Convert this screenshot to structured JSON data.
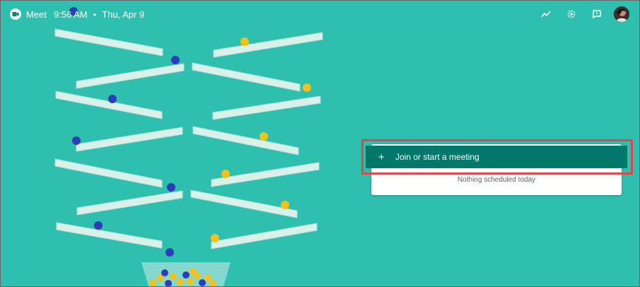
{
  "header": {
    "app_name": "Meet",
    "time": "9:56 AM",
    "separator": "•",
    "date": "Thu, Apr 9",
    "icons": [
      "activity-icon",
      "settings-icon",
      "feedback-icon",
      "avatar"
    ]
  },
  "main": {
    "join_label": "Join or start a meeting",
    "join_icon": "+",
    "schedule_empty": "Nothing scheduled today"
  },
  "colors": {
    "background": "#2fbfae",
    "join_button": "#00796b",
    "highlight": "#d9494f"
  }
}
